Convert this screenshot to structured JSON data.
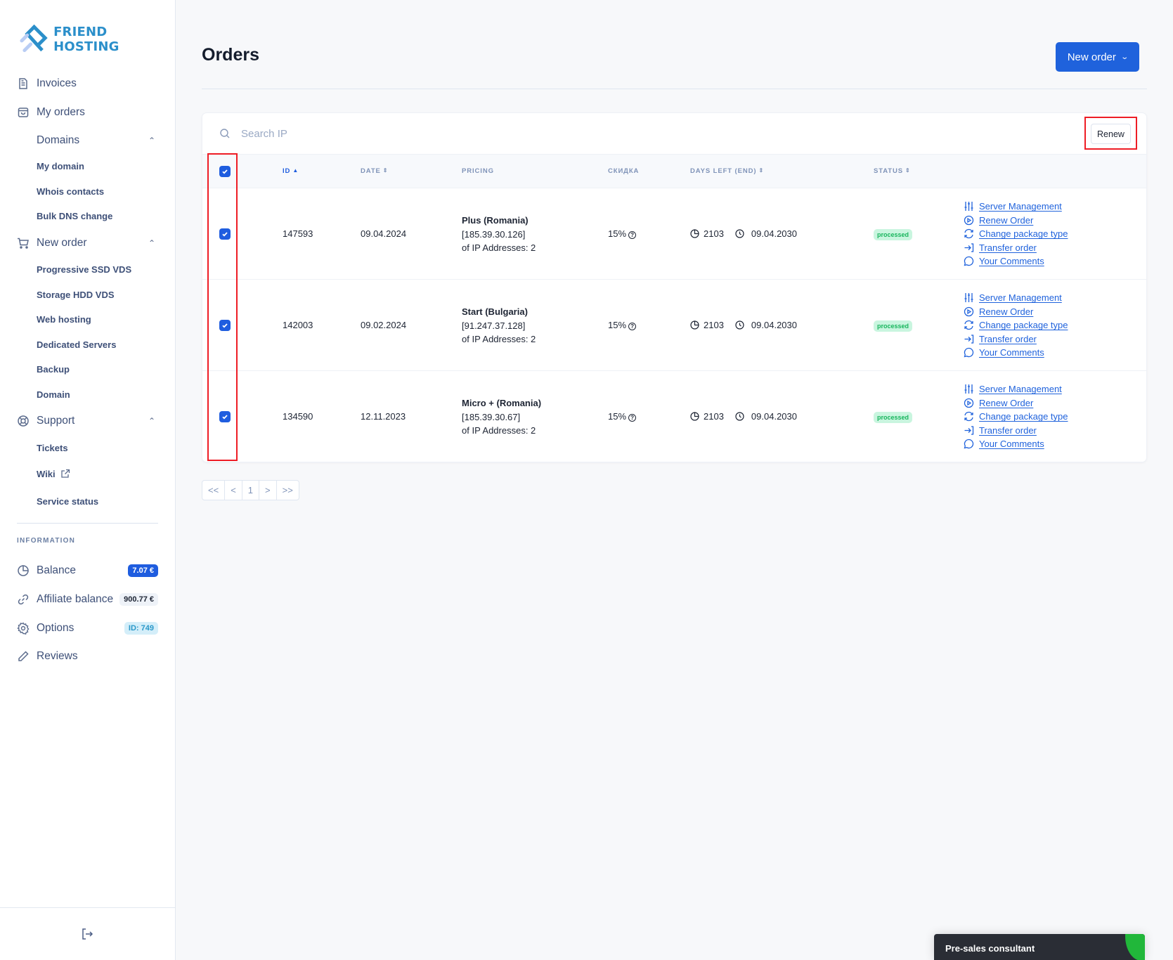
{
  "brand": {
    "name": "FRIEND HOSTING",
    "color": "#2b8fca"
  },
  "sidebar": {
    "items": [
      {
        "label": "Invoices",
        "icon": "invoice-icon"
      },
      {
        "label": "My orders",
        "icon": "bag-icon"
      },
      {
        "label": "Domains",
        "expanded": true,
        "children": [
          "My domain",
          "Whois contacts",
          "Bulk DNS change"
        ]
      },
      {
        "label": "New order",
        "icon": "cart-icon",
        "expanded": true,
        "children": [
          "Progressive SSD VDS",
          "Storage HDD VDS",
          "Web hosting",
          "Dedicated Servers",
          "Backup",
          "Domain"
        ]
      },
      {
        "label": "Support",
        "icon": "lifebuoy-icon",
        "expanded": true,
        "children": [
          "Tickets",
          "Wiki",
          "Service status"
        ]
      }
    ],
    "section_title": "INFORMATION",
    "info": [
      {
        "label": "Balance",
        "icon": "pie-icon",
        "badge": "7.07 €"
      },
      {
        "label": "Affiliate balance",
        "icon": "link-icon",
        "badge": "900.77 €"
      },
      {
        "label": "Options",
        "icon": "gear-icon",
        "badge": "ID: 749"
      },
      {
        "label": "Reviews",
        "icon": "pencil-icon"
      }
    ]
  },
  "header": {
    "title": "Orders",
    "new_order_label": "New order"
  },
  "table": {
    "search_placeholder": "Search IP",
    "search_value": "",
    "renew_label": "Renew",
    "select_all_checked": true,
    "columns": [
      {
        "label": "ID",
        "sort": "asc"
      },
      {
        "label": "DATE",
        "sort": "both"
      },
      {
        "label": "PRICING"
      },
      {
        "label": "СКИДКА"
      },
      {
        "label": "DAYS LEFT (END)",
        "sort": "both"
      },
      {
        "label": "STATUS",
        "sort": "both"
      }
    ],
    "rows": [
      {
        "checked": true,
        "id": "147593",
        "date": "09.04.2024",
        "plan": "Plus (Romania)",
        "ip": "[185.39.30.126]",
        "ip_count": "of IP Addresses: 2",
        "discount": "15%",
        "days_left": "2103",
        "end_date": "09.04.2030",
        "status": "processed"
      },
      {
        "checked": true,
        "id": "142003",
        "date": "09.02.2024",
        "plan": "Start (Bulgaria)",
        "ip": "[91.247.37.128]",
        "ip_count": "of IP Addresses: 2",
        "discount": "15%",
        "days_left": "2103",
        "end_date": "09.04.2030",
        "status": "processed"
      },
      {
        "checked": true,
        "id": "134590",
        "date": "12.11.2023",
        "plan": "Micro + (Romania)",
        "ip": "[185.39.30.67]",
        "ip_count": "of IP Addresses: 2",
        "discount": "15%",
        "days_left": "2103",
        "end_date": "09.04.2030",
        "status": "processed"
      }
    ],
    "actions": [
      "Server Management",
      "Renew Order",
      "Change package type",
      "Transfer order",
      "Your Comments"
    ]
  },
  "pagination": {
    "first": "<<",
    "prev": "<",
    "current": "1",
    "next": ">",
    "last": ">>"
  },
  "consultant": {
    "label": "Pre-sales consultant"
  },
  "colors": {
    "accent": "#1f62dc",
    "status_processed": "#17b55c",
    "highlight": "#ee1c25"
  }
}
